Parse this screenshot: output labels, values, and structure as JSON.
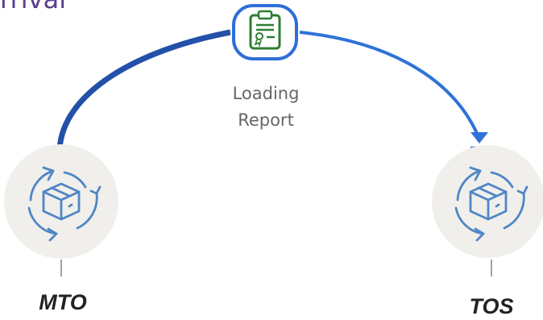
{
  "header": {
    "title": "rrival"
  },
  "center": {
    "line1": "Loading",
    "line2": "Report"
  },
  "nodes": {
    "left": {
      "label": "MTO"
    },
    "right": {
      "label": "TOS"
    }
  },
  "colors": {
    "arc_start": "#2b59b8",
    "arc_end": "#2f7ae5",
    "icon_blue": "#4f86c6",
    "report_green": "#2e7d32",
    "node_bg": "#f2f0ec"
  },
  "icons": {
    "report": "clipboard-report-icon",
    "node": "box-cycle-icon"
  }
}
